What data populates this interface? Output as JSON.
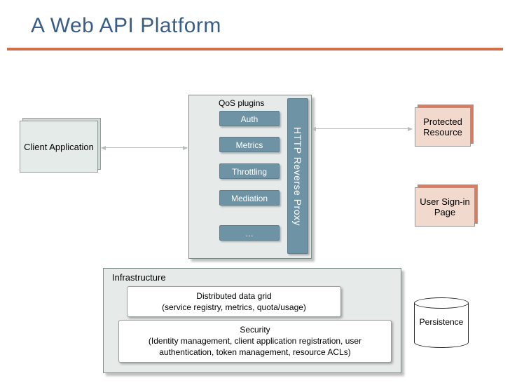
{
  "title": "A Web API Platform",
  "client": "Client Application",
  "qos_label": "QoS plugins",
  "plugins": {
    "auth": "Auth",
    "metrics": "Metrics",
    "throttling": "Throttling",
    "mediation": "Mediation",
    "more": "…"
  },
  "proxy": "HTTP Reverse Proxy",
  "protected": "Protected Resource",
  "signin": "User Sign-in Page",
  "infra_label": "Infrastructure",
  "datagrid_title": "Distributed data grid",
  "datagrid_sub": "(service registry, metrics, quota/usage)",
  "security_title": "Security",
  "security_sub": "(Identity management, client application registration, user authentication, token management, resource ACLs)",
  "persistence": "Persistence"
}
